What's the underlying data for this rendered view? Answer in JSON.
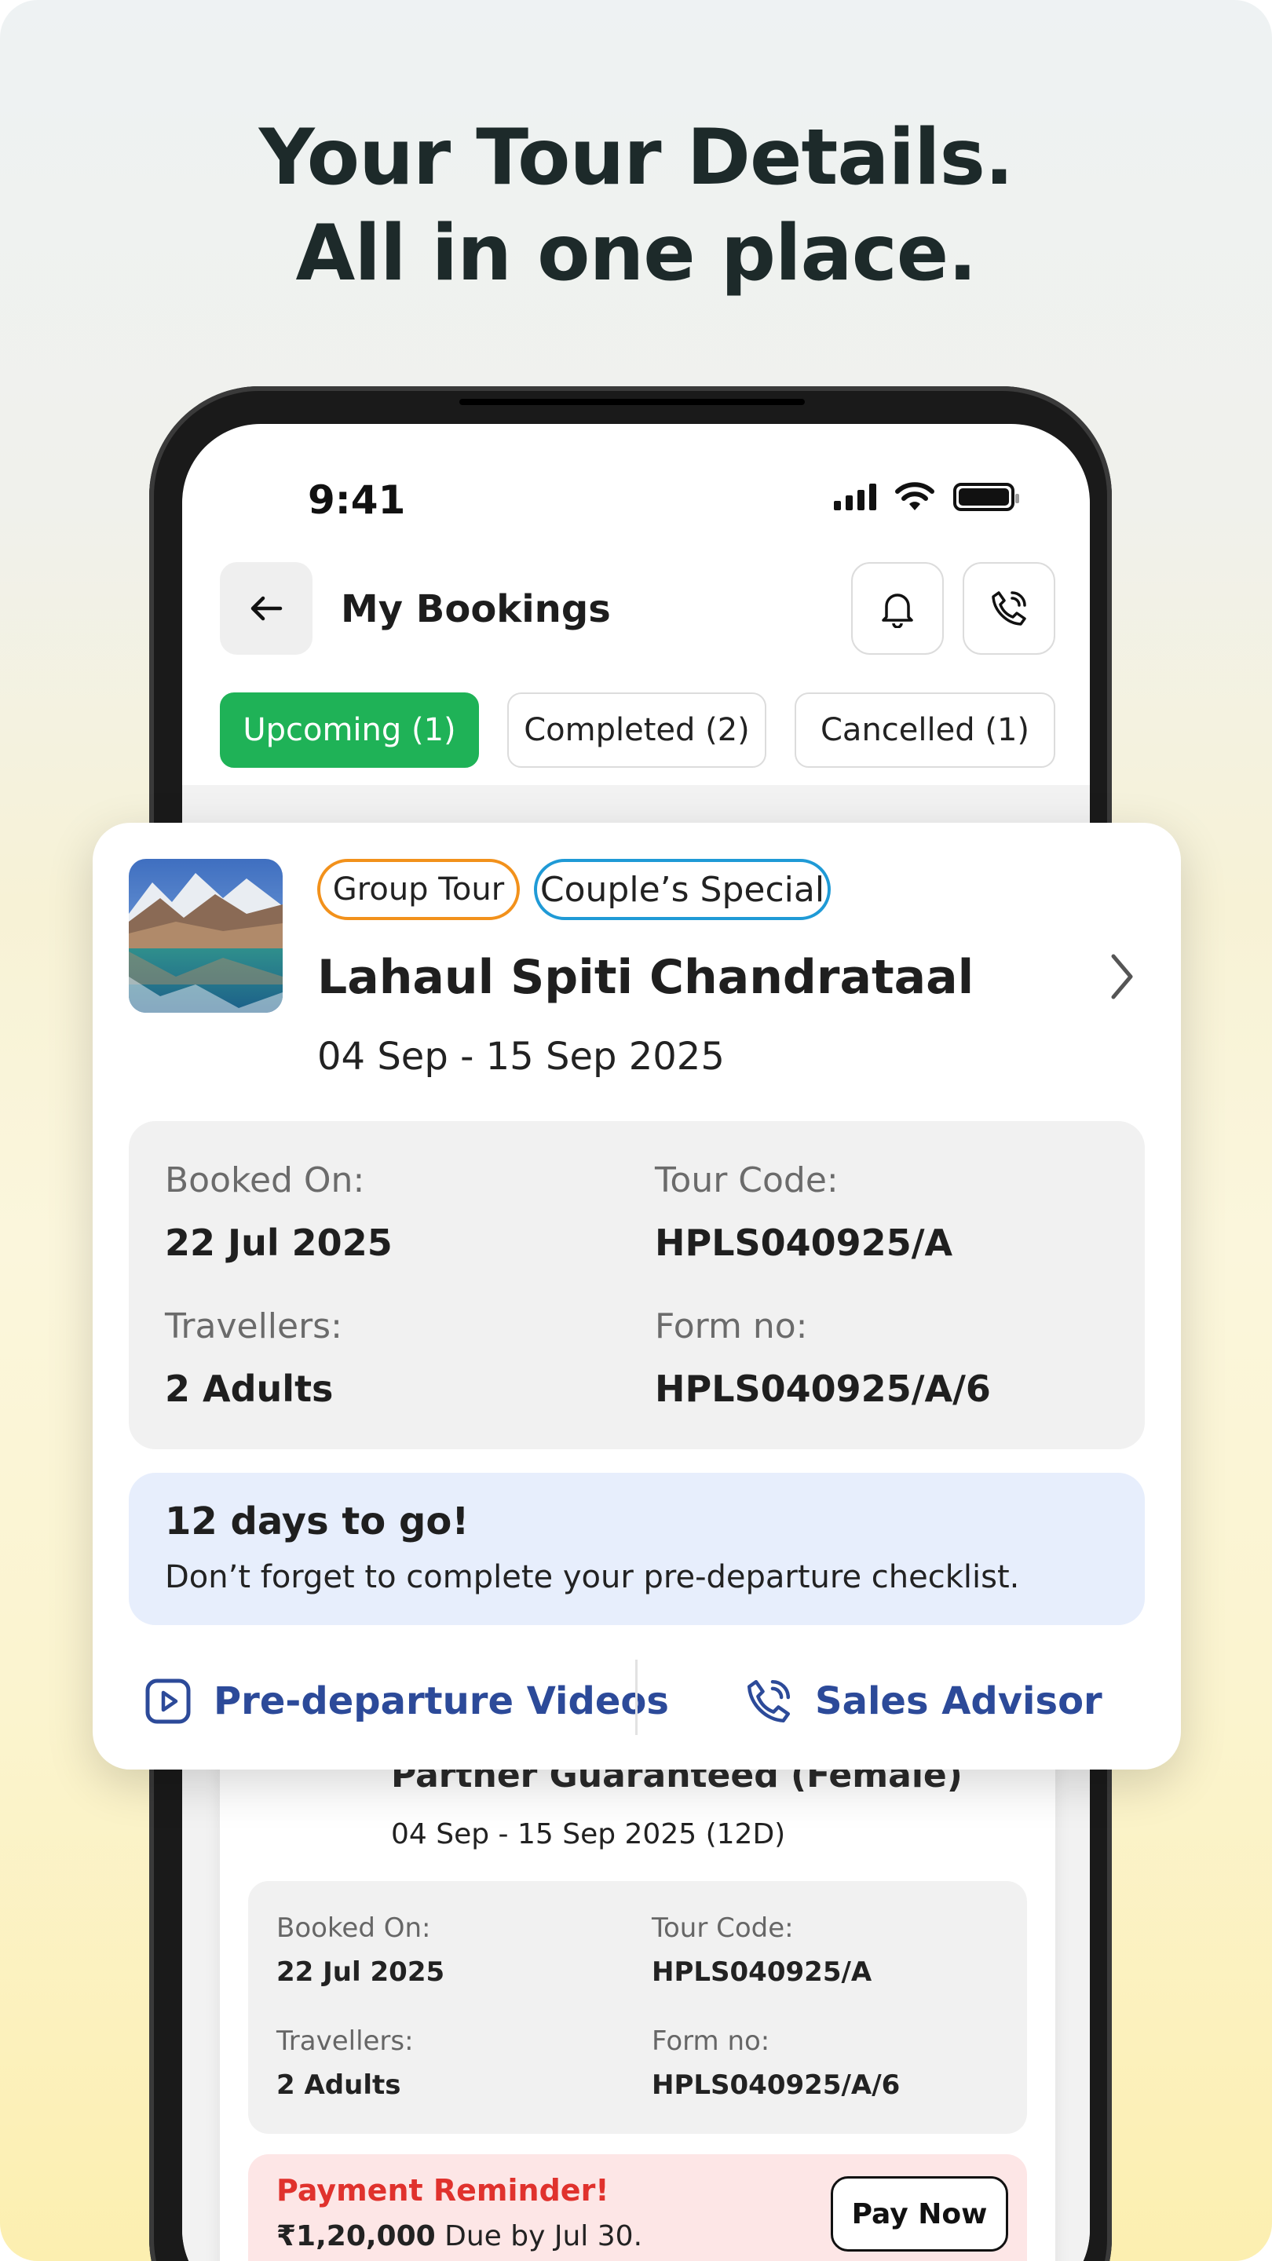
{
  "headline": {
    "line1": "Your Tour Details.",
    "line2": "All in one place."
  },
  "status_bar": {
    "time": "9:41",
    "icons": [
      "signal-icon",
      "wifi-icon",
      "battery-icon"
    ]
  },
  "app_bar": {
    "title": "My Bookings",
    "back_icon": "arrow-left-icon",
    "actions": [
      "bell-icon",
      "phone-call-icon"
    ]
  },
  "tabs": [
    {
      "label": "Upcoming (1)",
      "active": true
    },
    {
      "label": "Completed (2)",
      "active": false
    },
    {
      "label": "Cancelled (1)",
      "active": false
    }
  ],
  "featured_booking": {
    "tags": [
      "Group Tour",
      "Couple’s Special"
    ],
    "name": "Lahaul Spiti Chandrataal",
    "dates": "04 Sep - 15 Sep 2025",
    "booked_on_label": "Booked On:",
    "booked_on": "22 Jul 2025",
    "tour_code_label": "Tour Code:",
    "tour_code": "HPLS040925/A",
    "travellers_label": "Travellers:",
    "travellers": "2 Adults",
    "form_no_label": "Form no:",
    "form_no": "HPLS040925/A/6",
    "countdown_title": "12 days to go!",
    "countdown_text": "Don’t forget to complete your pre-departure checklist.",
    "action_videos": "Pre-departure Videos",
    "action_advisor": "Sales Advisor"
  },
  "second_booking": {
    "name": "Partner Guaranteed (Female)",
    "dates": "04 Sep - 15 Sep 2025 (12D)",
    "booked_on_label": "Booked On:",
    "booked_on": "22 Jul 2025",
    "tour_code_label": "Tour Code:",
    "tour_code": "HPLS040925/A",
    "travellers_label": "Travellers:",
    "travellers": "2 Adults",
    "form_no_label": "Form no:",
    "form_no": "HPLS040925/A/6",
    "reminder_title": "Payment Reminder!",
    "reminder_amount": "₹1,20,000",
    "reminder_due": " Due by Jul 30.",
    "pay_button": "Pay Now"
  },
  "colors": {
    "green": "#1fb257",
    "orange_tag": "#f2911b",
    "blue_tag": "#1f9ad6",
    "link_blue": "#2c4a99",
    "reminder_red": "#e0322d"
  }
}
